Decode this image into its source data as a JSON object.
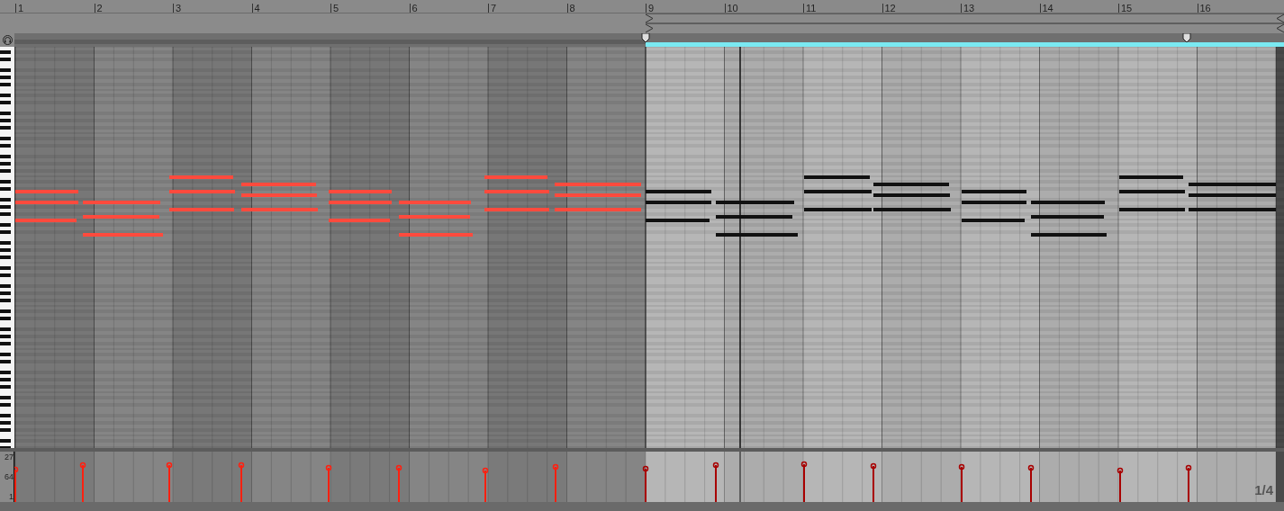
{
  "ruler": {
    "bar_numbers": [
      "1",
      "2",
      "3",
      "4",
      "5",
      "6",
      "7",
      "8",
      "9",
      "10",
      "11",
      "12",
      "13",
      "14",
      "15",
      "16"
    ]
  },
  "velocity_lane": {
    "axis_labels": [
      "27",
      "64",
      "1"
    ]
  },
  "zoom_label": "1/4"
}
